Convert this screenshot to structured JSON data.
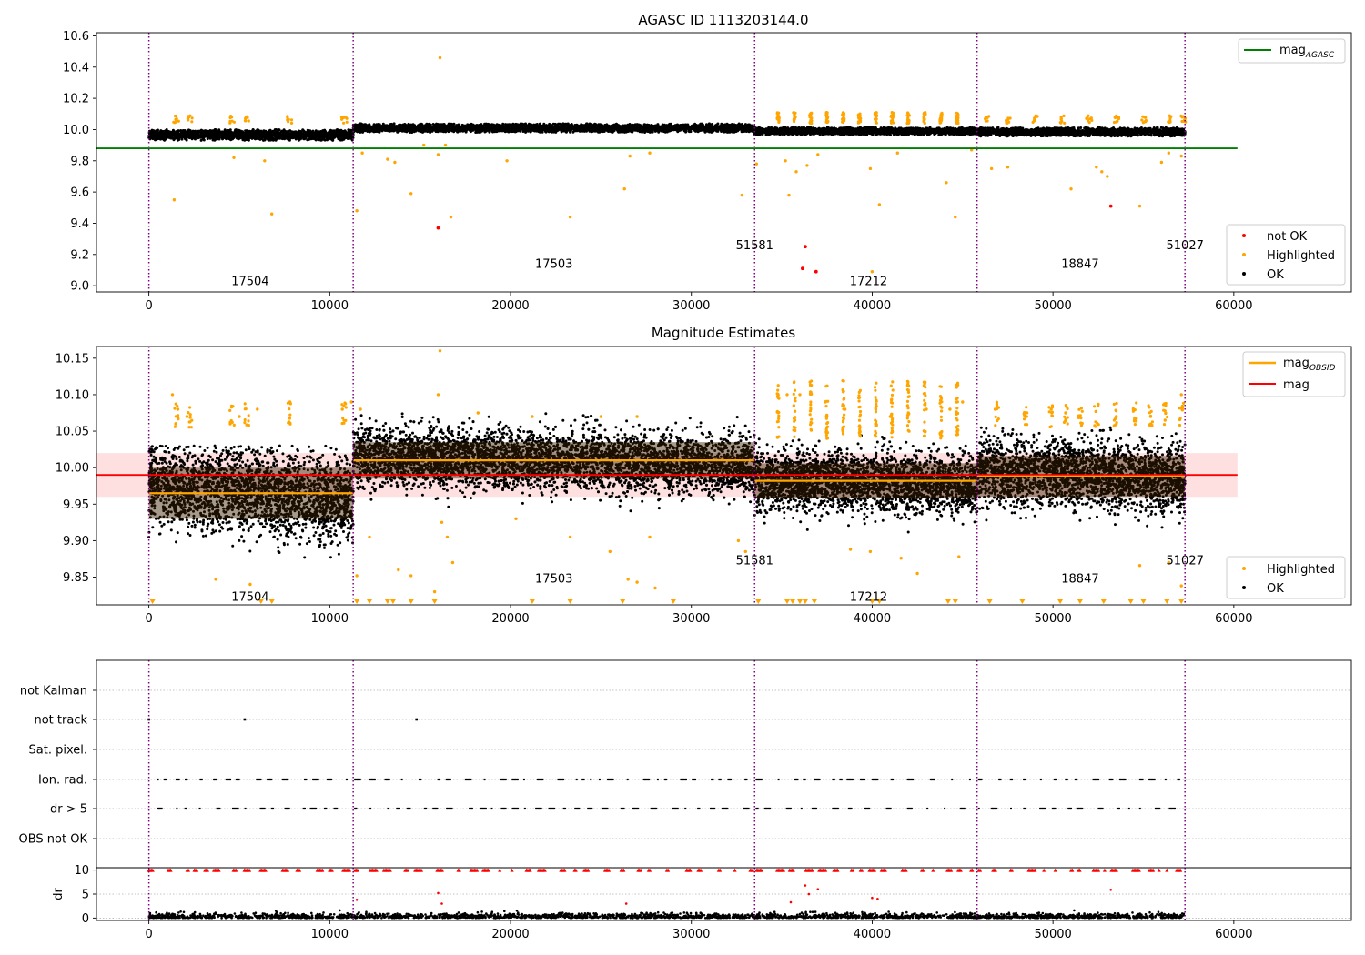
{
  "chart_data": [
    {
      "type": "scatter",
      "title": "AGASC ID 1113203144.0",
      "xlim": [
        -2900,
        66500
      ],
      "ylim": [
        8.96,
        10.62
      ],
      "x_ticks": [
        0,
        10000,
        20000,
        30000,
        40000,
        50000,
        60000
      ],
      "y_ticks": [
        9.0,
        9.2,
        9.4,
        9.6,
        9.8,
        10.0,
        10.2,
        10.4,
        10.6
      ],
      "obs_boundaries": [
        0,
        11300,
        33500,
        45800,
        57300
      ],
      "obs_labels": [
        {
          "text": "17504",
          "x": 5600,
          "y": 9.03
        },
        {
          "text": "17503",
          "x": 22400,
          "y": 9.14
        },
        {
          "text": "51581",
          "x": 33500,
          "y": 9.26
        },
        {
          "text": "17212",
          "x": 39800,
          "y": 9.03
        },
        {
          "text": "18847",
          "x": 51500,
          "y": 9.14
        },
        {
          "text": "51027",
          "x": 57300,
          "y": 9.26
        }
      ],
      "reference_line": {
        "name": "mag",
        "name_sub": "AGASC",
        "value": 9.88,
        "x_range": [
          -2900,
          60200
        ],
        "color": "#008000"
      },
      "ok_bands": [
        {
          "x0": 0,
          "x1": 11300,
          "center": 9.965,
          "spread": 0.035
        },
        {
          "x0": 11300,
          "x1": 33500,
          "center": 10.01,
          "spread": 0.028
        },
        {
          "x0": 33500,
          "x1": 45800,
          "center": 9.99,
          "spread": 0.025
        },
        {
          "x0": 45800,
          "x1": 57300,
          "center": 9.985,
          "spread": 0.028
        }
      ],
      "series": [
        {
          "name": "not OK",
          "color": "#ff0000",
          "points": [
            [
              16000,
              9.37
            ],
            [
              36300,
              9.25
            ],
            [
              36150,
              9.11
            ],
            [
              36900,
              9.09
            ],
            [
              53200,
              9.51
            ]
          ]
        },
        {
          "name": "Highlighted",
          "color": "#ffa500",
          "points": [
            [
              1400,
              9.55
            ],
            [
              4700,
              9.82
            ],
            [
              6400,
              9.8
            ],
            [
              6800,
              9.46
            ],
            [
              11500,
              9.48
            ],
            [
              11800,
              9.85
            ],
            [
              13200,
              9.81
            ],
            [
              13600,
              9.79
            ],
            [
              14500,
              9.59
            ],
            [
              15200,
              9.9
            ],
            [
              16000,
              9.84
            ],
            [
              16100,
              10.46
            ],
            [
              16400,
              9.9
            ],
            [
              16700,
              9.44
            ],
            [
              19800,
              9.8
            ],
            [
              23300,
              9.44
            ],
            [
              26300,
              9.62
            ],
            [
              26600,
              9.83
            ],
            [
              27700,
              9.85
            ],
            [
              32800,
              9.58
            ],
            [
              33600,
              9.78
            ],
            [
              35200,
              9.8
            ],
            [
              35400,
              9.58
            ],
            [
              35800,
              9.73
            ],
            [
              36400,
              9.77
            ],
            [
              37000,
              9.84
            ],
            [
              39900,
              9.75
            ],
            [
              40000,
              9.09
            ],
            [
              40400,
              9.52
            ],
            [
              41400,
              9.85
            ],
            [
              44100,
              9.66
            ],
            [
              44600,
              9.44
            ],
            [
              45500,
              9.87
            ],
            [
              46600,
              9.75
            ],
            [
              47500,
              9.76
            ],
            [
              51000,
              9.62
            ],
            [
              52400,
              9.76
            ],
            [
              52700,
              9.73
            ],
            [
              53000,
              9.7
            ],
            [
              54800,
              9.51
            ],
            [
              56000,
              9.79
            ],
            [
              56400,
              9.85
            ],
            [
              57100,
              9.83
            ]
          ]
        },
        {
          "name": "OK",
          "color": "#000000",
          "points": []
        }
      ]
    },
    {
      "type": "scatter",
      "title": "Magnitude Estimates",
      "xlim": [
        -2900,
        66500
      ],
      "ylim": [
        9.812,
        10.166
      ],
      "x_ticks": [
        0,
        10000,
        20000,
        30000,
        40000,
        50000,
        60000
      ],
      "y_ticks": [
        9.85,
        9.9,
        9.95,
        10.0,
        10.05,
        10.1,
        10.15
      ],
      "obs_boundaries": [
        0,
        11300,
        33500,
        45800,
        57300
      ],
      "obs_labels": [
        {
          "text": "17504",
          "x": 5600,
          "y": 9.823
        },
        {
          "text": "17503",
          "x": 22400,
          "y": 9.848
        },
        {
          "text": "51581",
          "x": 33500,
          "y": 9.873
        },
        {
          "text": "17212",
          "x": 39800,
          "y": 9.823
        },
        {
          "text": "18847",
          "x": 51500,
          "y": 9.848
        },
        {
          "text": "51027",
          "x": 57300,
          "y": 9.873
        }
      ],
      "mean_band": {
        "value": 9.99,
        "lower": 9.96,
        "upper": 10.02,
        "x_range": [
          -2900,
          60200
        ],
        "color": "#ff0000"
      },
      "obsid_means": [
        {
          "x0": 0,
          "x1": 11300,
          "value": 9.965,
          "lower": 9.93,
          "upper": 10.0
        },
        {
          "x0": 11300,
          "x1": 33500,
          "value": 10.01,
          "lower": 9.985,
          "upper": 10.035
        },
        {
          "x0": 33500,
          "x1": 45800,
          "value": 9.982,
          "lower": 9.958,
          "upper": 10.006
        },
        {
          "x0": 45800,
          "x1": 57300,
          "value": 9.988,
          "lower": 9.96,
          "upper": 10.016
        }
      ],
      "series": [
        {
          "name": "mag",
          "name_sub": "OBSID",
          "type": "line",
          "color": "#ffa500"
        },
        {
          "name": "mag",
          "type": "line",
          "color": "#ff0000"
        },
        {
          "name": "Highlighted",
          "color": "#ffa500",
          "points": [
            [
              1300,
              10.1
            ],
            [
              1600,
              10.08
            ],
            [
              2100,
              10.07
            ],
            [
              4500,
              10.06
            ],
            [
              5000,
              10.07
            ],
            [
              6000,
              10.08
            ],
            [
              7800,
              10.09
            ],
            [
              10700,
              10.08
            ],
            [
              11200,
              10.09
            ],
            [
              11700,
              10.08
            ],
            [
              16000,
              10.1
            ],
            [
              16100,
              10.16
            ],
            [
              18200,
              10.075
            ],
            [
              21200,
              10.07
            ],
            [
              25000,
              10.07
            ],
            [
              27000,
              10.07
            ],
            [
              3700,
              9.847
            ],
            [
              5600,
              9.84
            ],
            [
              11500,
              9.852
            ],
            [
              12200,
              9.905
            ],
            [
              13800,
              9.86
            ],
            [
              14500,
              9.852
            ],
            [
              16200,
              9.925
            ],
            [
              16500,
              9.905
            ],
            [
              16800,
              9.87
            ],
            [
              15800,
              9.83
            ],
            [
              20300,
              9.93
            ],
            [
              23300,
              9.905
            ],
            [
              25500,
              9.885
            ],
            [
              26500,
              9.847
            ],
            [
              27000,
              9.843
            ],
            [
              27700,
              9.905
            ],
            [
              28000,
              9.835
            ],
            [
              32600,
              9.9
            ],
            [
              33000,
              9.885
            ],
            [
              35300,
              10.1
            ],
            [
              36000,
              10.1
            ],
            [
              37400,
              10.09
            ],
            [
              38500,
              10.08
            ],
            [
              40200,
              10.08
            ],
            [
              41000,
              10.07
            ],
            [
              42000,
              10.075
            ],
            [
              43000,
              10.08
            ],
            [
              44300,
              10.08
            ],
            [
              45000,
              10.09
            ],
            [
              46800,
              10.08
            ],
            [
              48500,
              10.07
            ],
            [
              49900,
              10.08
            ],
            [
              50700,
              10.075
            ],
            [
              51500,
              10.07
            ],
            [
              53500,
              10.07
            ],
            [
              54500,
              10.065
            ],
            [
              55400,
              10.07
            ],
            [
              56200,
              10.065
            ],
            [
              57100,
              10.1
            ],
            [
              38800,
              9.888
            ],
            [
              39900,
              9.885
            ],
            [
              41600,
              9.876
            ],
            [
              42500,
              9.855
            ],
            [
              44800,
              9.878
            ],
            [
              54800,
              9.866
            ],
            [
              56400,
              9.87
            ],
            [
              57100,
              9.838
            ]
          ]
        },
        {
          "name": "OK",
          "color": "#000000",
          "points": []
        }
      ]
    },
    {
      "type": "scatter",
      "categories": [
        "not Kalman",
        "not track",
        "Sat. pixel.",
        "Ion. rad.",
        "dr > 5",
        "OBS not OK"
      ],
      "xlim": [
        -2900,
        66500
      ],
      "x_ticks": [],
      "obs_boundaries": [
        0,
        11300,
        33500,
        45800,
        57300
      ],
      "series": [
        {
          "name": "not track",
          "points": [
            [
              0,
              1
            ],
            [
              5300,
              1
            ],
            [
              14800,
              1
            ]
          ]
        },
        {
          "name": "Ion. rad.",
          "x_ranges": [
            [
              500,
              11200
            ],
            [
              11400,
              33400
            ],
            [
              33600,
              45700
            ],
            [
              45900,
              57300
            ]
          ]
        },
        {
          "name": "dr > 5",
          "x_ranges": [
            [
              500,
              11200
            ],
            [
              11400,
              33400
            ],
            [
              33600,
              45700
            ],
            [
              45900,
              57300
            ]
          ]
        }
      ]
    },
    {
      "type": "scatter",
      "ylabel": "dr",
      "xlim": [
        -2900,
        66500
      ],
      "ylim": [
        -0.5,
        10.5
      ],
      "x_ticks": [
        0,
        10000,
        20000,
        30000,
        40000,
        50000,
        60000
      ],
      "y_ticks": [
        0,
        5,
        10
      ],
      "obs_boundaries": [
        0,
        11300,
        33500,
        45800,
        57300
      ],
      "series": [
        {
          "name": "dr capped",
          "color": "#ff0000",
          "marker": "triangle-up",
          "value": 10,
          "x_ranges": [
            [
              0,
              11300
            ],
            [
              11400,
              33400
            ],
            [
              33600,
              45700
            ],
            [
              45900,
              57300
            ]
          ]
        },
        {
          "name": "dr outliers",
          "color": "#ff0000",
          "points": [
            [
              11500,
              3.8
            ],
            [
              16000,
              5.2
            ],
            [
              16200,
              3.0
            ],
            [
              26400,
              3.0
            ],
            [
              35500,
              3.3
            ],
            [
              36300,
              6.8
            ],
            [
              36500,
              5.0
            ],
            [
              37000,
              6.0
            ],
            [
              40000,
              4.2
            ],
            [
              40300,
              4.0
            ],
            [
              53200,
              5.9
            ]
          ]
        },
        {
          "name": "dr ok",
          "color": "#000000",
          "band": [
            0,
            1.5
          ]
        }
      ]
    }
  ],
  "legends": {
    "agasc": {
      "mag": "mag",
      "mag_sub": "AGASC"
    },
    "top_points": {
      "not_ok": "not OK",
      "highlighted": "Highlighted",
      "ok": "OK"
    },
    "mag_lines": {
      "obsid": "mag",
      "obsid_sub": "OBSID",
      "mag": "mag"
    },
    "mag_points": {
      "highlighted": "Highlighted",
      "ok": "OK"
    }
  },
  "colors": {
    "ok": "#000000",
    "highlighted": "#ffa500",
    "not_ok": "#ff0000",
    "agasc_line": "#008000",
    "boundary": "#800080",
    "mean_band_fill": "#ffcccc",
    "grid": "#b0b0b0"
  }
}
